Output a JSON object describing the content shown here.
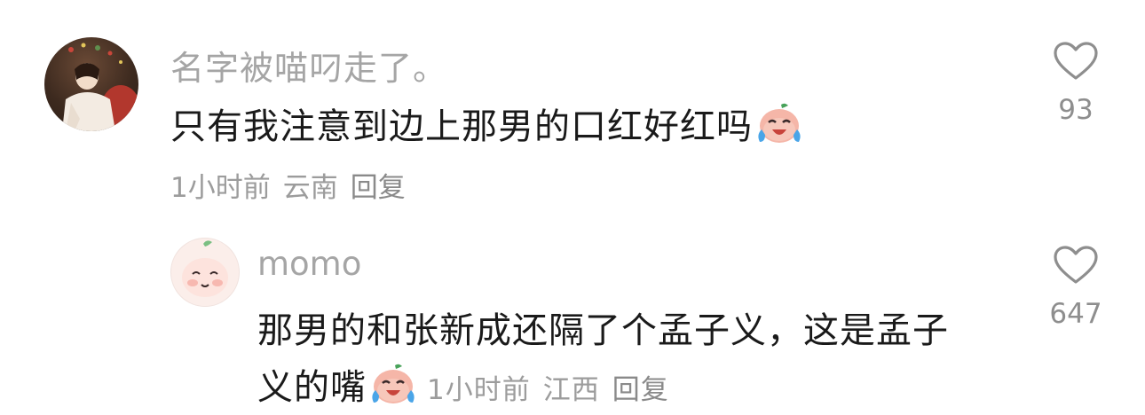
{
  "comments": [
    {
      "username": "名字被喵叼走了。",
      "text": "只有我注意到边上那男的口红好红吗",
      "emoji": "crying-laughing-peach-emoji",
      "time": "1小时前",
      "location": "云南",
      "reply_label": "回复",
      "likes": "93"
    },
    {
      "username": "momo",
      "text_line1": "那男的和张新成还隔了个孟子义，这是孟子",
      "text_line2": "义的嘴",
      "emoji": "crying-laughing-peach-emoji",
      "time": "1小时前",
      "location": "江西",
      "reply_label": "回复",
      "likes": "647"
    }
  ],
  "icons": {
    "like": "heart-outline-icon"
  },
  "colors": {
    "username": "#a5a5a5",
    "text": "#1a1a1a",
    "meta": "#9c9c9c",
    "heart": "#8e8e8e"
  }
}
